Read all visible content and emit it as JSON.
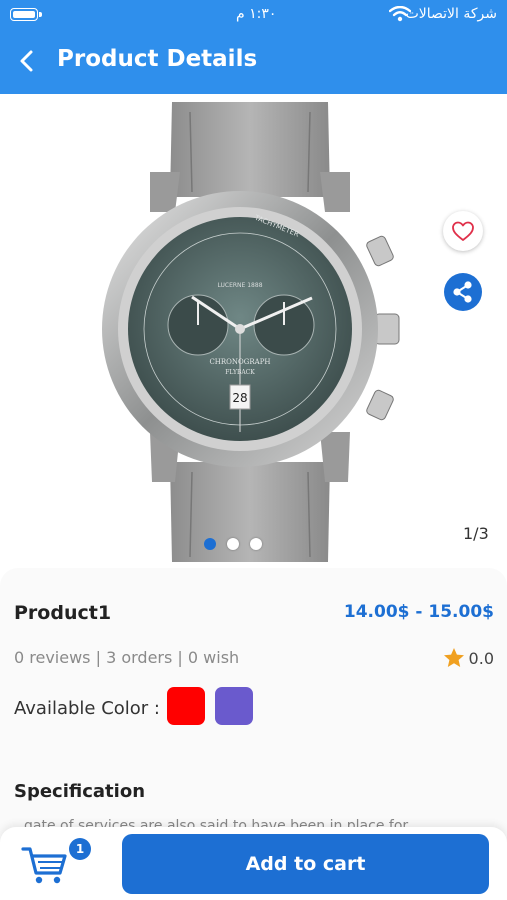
{
  "status_bar": {
    "time": "١:٣٠ م",
    "carrier": "شركة الاتصالات"
  },
  "app_bar": {
    "title": "Product Details"
  },
  "gallery": {
    "counter": "1/3",
    "total_images": 3,
    "active_index": 0,
    "watch_dial": {
      "brand": "LUCERNE 1888",
      "tachymeter": "TACHYMETER",
      "line1": "CHRONOGRAPH",
      "line2": "FLYBACK",
      "date": "28"
    }
  },
  "product": {
    "name": "Product1",
    "price": "14.00$ - 15.00$",
    "stats": "0 reviews | 3 orders | 0 wish",
    "rating": "0.0",
    "colors_label": "Available Color :",
    "colors": [
      "#ff0000",
      "#6a5acd"
    ],
    "spec_title": "Specification",
    "spec_text": "gate of services are also said to have been in place for"
  },
  "cart": {
    "badge": "1",
    "add_label": "Add to cart"
  },
  "theme": {
    "primary": "#2f8fec",
    "accent": "#1d6fd3",
    "star": "#f0a020",
    "heart": "#e0304a"
  },
  "icons": [
    "battery-icon",
    "wifi-icon",
    "back-arrow-icon",
    "heart-icon",
    "share-icon",
    "star-icon",
    "cart-icon"
  ]
}
